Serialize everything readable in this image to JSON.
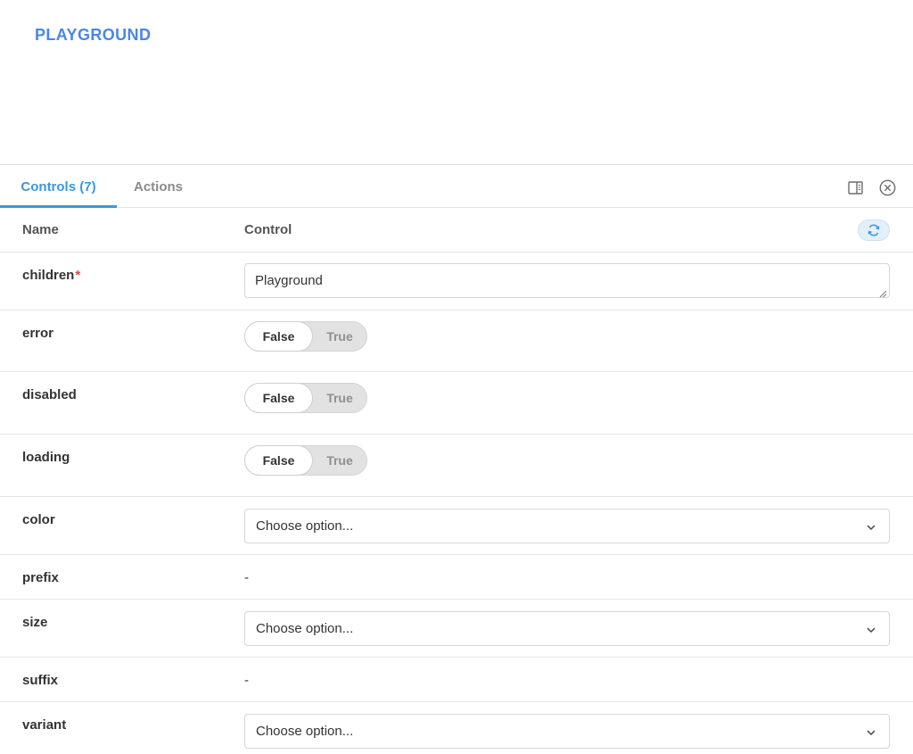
{
  "preview": {
    "button_label": "PLAYGROUND"
  },
  "tabs": {
    "controls_label": "Controls (7)",
    "actions_label": "Actions"
  },
  "icons": {
    "layout": "panel-layout-icon",
    "close": "close-circle-icon",
    "reset": "refresh-icon",
    "chevron": "chevron-down-icon"
  },
  "table": {
    "header_name": "Name",
    "header_control": "Control"
  },
  "rows": {
    "children": {
      "name": "children",
      "required_mark": "*",
      "value": "Playground"
    },
    "error": {
      "name": "error",
      "false_label": "False",
      "true_label": "True",
      "selected": "False"
    },
    "disabled": {
      "name": "disabled",
      "false_label": "False",
      "true_label": "True",
      "selected": "False"
    },
    "loading": {
      "name": "loading",
      "false_label": "False",
      "true_label": "True",
      "selected": "False"
    },
    "color": {
      "name": "color",
      "placeholder": "Choose option..."
    },
    "prefix": {
      "name": "prefix",
      "value": "-"
    },
    "size": {
      "name": "size",
      "placeholder": "Choose option..."
    },
    "suffix": {
      "name": "suffix",
      "value": "-"
    },
    "variant": {
      "name": "variant",
      "placeholder": "Choose option..."
    }
  },
  "colors": {
    "accent": "#3b97dc",
    "preview_button": "#4a86e8",
    "required": "#e0483c"
  }
}
